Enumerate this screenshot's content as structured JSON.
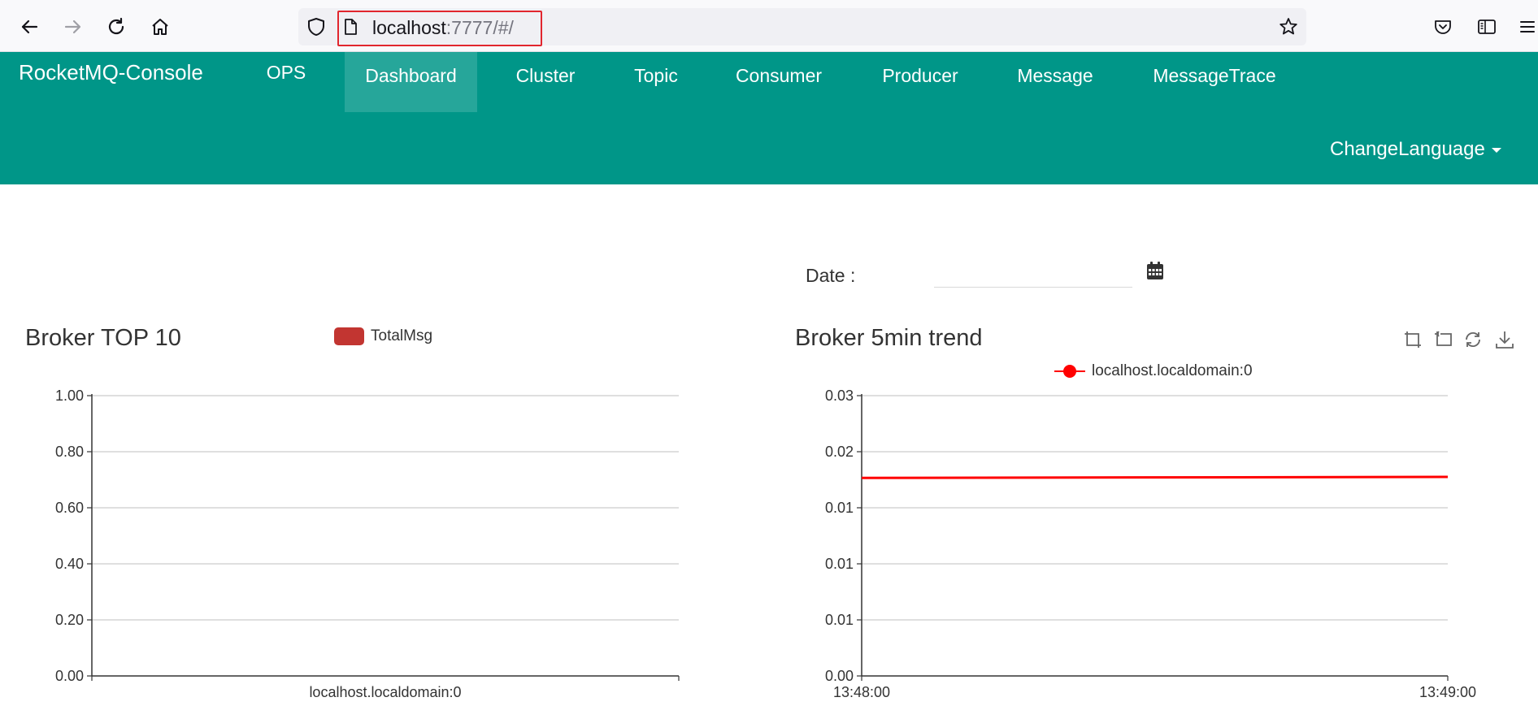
{
  "browser": {
    "url_host": "localhost",
    "url_path": ":7777/#/",
    "icons": [
      "back-arrow-icon",
      "forward-arrow-icon",
      "reload-icon",
      "home-icon",
      "shield-icon",
      "page-icon",
      "bookmark-star-icon",
      "pocket-icon",
      "sidebar-icon",
      "menu-icon"
    ]
  },
  "navbar": {
    "brand": "RocketMQ-Console",
    "items": [
      {
        "label": "OPS"
      },
      {
        "label": "Dashboard"
      },
      {
        "label": "Cluster"
      },
      {
        "label": "Topic"
      },
      {
        "label": "Consumer"
      },
      {
        "label": "Producer"
      },
      {
        "label": "Message"
      },
      {
        "label": "MessageTrace"
      }
    ],
    "active": "Dashboard",
    "language": "ChangeLanguage",
    "color": "#009688",
    "active_color": "#26a69a"
  },
  "date_filter": {
    "label": "Date :",
    "value": "",
    "icon": "calendar-icon"
  },
  "toolbox_icons": [
    "zoom-select-icon",
    "zoom-reset-icon",
    "restore-icon",
    "save-image-icon"
  ],
  "chart_data": [
    {
      "type": "bar",
      "title": "Broker TOP 10",
      "categories": [
        "localhost.localdomain:0"
      ],
      "series": [
        {
          "name": "TotalMsg",
          "values": [
            0
          ],
          "color": "#c23531"
        }
      ],
      "ylim": [
        0,
        1
      ],
      "yticks": [
        "0.00",
        "0.20",
        "0.40",
        "0.60",
        "0.80",
        "1.00"
      ],
      "legend": "top-center",
      "grid": true
    },
    {
      "type": "line",
      "title": "Broker 5min trend",
      "x": [
        "13:48:00",
        "13:49:00"
      ],
      "series": [
        {
          "name": "localhost.localdomain:0",
          "values": [
            0.0212,
            0.0213
          ],
          "color": "#ff0000"
        }
      ],
      "ylim": [
        0,
        0.03
      ],
      "yticks": [
        "0.00",
        "0.01",
        "0.01",
        "0.01",
        "0.02",
        "0.03"
      ],
      "legend": "top-center",
      "grid": true
    }
  ]
}
